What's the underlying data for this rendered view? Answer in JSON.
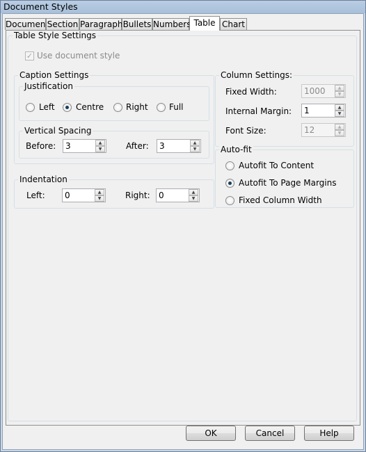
{
  "window": {
    "title": "Document Styles"
  },
  "tabs": [
    {
      "label": "Document"
    },
    {
      "label": "Section"
    },
    {
      "label": "Paragraph"
    },
    {
      "label": "Bullets"
    },
    {
      "label": "Numbers"
    },
    {
      "label": "Table"
    },
    {
      "label": "Chart"
    }
  ],
  "table_style": {
    "title": "Table Style Settings",
    "use_document_style": "Use document style"
  },
  "caption": {
    "title": "Caption Settings",
    "justification": {
      "title": "Justification",
      "left": "Left",
      "centre": "Centre",
      "right": "Right",
      "full": "Full"
    },
    "vertical_spacing": {
      "title": "Vertical Spacing",
      "before_label": "Before:",
      "before_value": "3",
      "after_label": "After:",
      "after_value": "3"
    }
  },
  "indentation": {
    "title": "Indentation",
    "left_label": "Left:",
    "left_value": "0",
    "right_label": "Right:",
    "right_value": "0"
  },
  "column": {
    "title": "Column Settings:",
    "fixed_width_label": "Fixed Width:",
    "fixed_width_value": "1000",
    "internal_margin_label": "Internal Margin:",
    "internal_margin_value": "1",
    "font_size_label": "Font Size:",
    "font_size_value": "12"
  },
  "autofit": {
    "title": "Auto-fit",
    "content": "Autofit To Content",
    "page_margins": "Autofit To Page Margins",
    "fixed": "Fixed Column Width"
  },
  "buttons": {
    "ok": "OK",
    "cancel": "Cancel",
    "help": "Help"
  }
}
